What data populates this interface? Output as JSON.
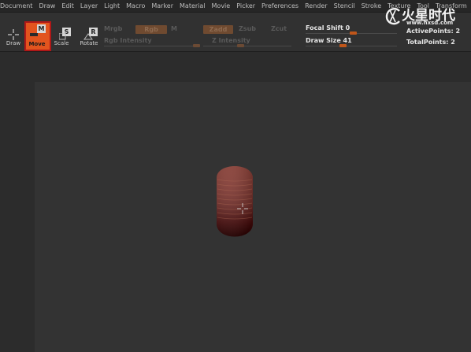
{
  "menu": [
    "Document",
    "Draw",
    "Edit",
    "Layer",
    "Light",
    "Macro",
    "Marker",
    "Material",
    "Movie",
    "Picker",
    "Preferences",
    "Render",
    "Stencil",
    "Stroke",
    "Texture",
    "Tool",
    "Transform"
  ],
  "tools": {
    "draw": {
      "label": "Draw"
    },
    "move": {
      "label": "Move",
      "hotkey": "M"
    },
    "scale": {
      "label": "Scale",
      "hotkey": "S"
    },
    "rotate": {
      "label": "Rotate",
      "hotkey": "R"
    }
  },
  "color_options": {
    "mrgb": "Mrgb",
    "rgb": "Rgb",
    "m": "M",
    "rgb_intensity": "Rgb Intensity"
  },
  "z_options": {
    "zadd": "Zadd",
    "zsub": "Zsub",
    "zcut": "Zcut",
    "z_intensity": "Z Intensity"
  },
  "focal_shift": {
    "label": "Focal Shift",
    "value": "0"
  },
  "draw_size": {
    "label": "Draw Size",
    "value": "41"
  },
  "active_points": {
    "label": "ActivePoints:",
    "value": "2"
  },
  "total_points": {
    "label": "TotalPoints:",
    "value": "2"
  },
  "logo": {
    "text": "火星时代",
    "url": "www.hxsd.com"
  },
  "colors": {
    "accent": "#e2541e",
    "active_border": "#b01818",
    "model_top": "#7a2a24",
    "model_bottom": "#3c0505"
  }
}
